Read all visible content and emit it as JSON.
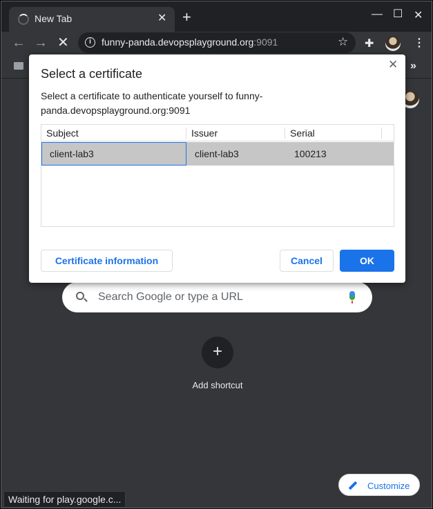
{
  "tab": {
    "title": "New Tab",
    "close": "✕"
  },
  "toolbar": {
    "url_host": "funny-panda.devopsplayground.org",
    "url_port": ":9091"
  },
  "ntp": {
    "search_placeholder": "Search Google or type a URL",
    "shortcut_plus": "+",
    "shortcut_label": "Add shortcut",
    "customize_label": "Customize"
  },
  "status_bar": {
    "text": "Waiting for play.google.c..."
  },
  "dialog": {
    "title": "Select a certificate",
    "close": "✕",
    "message": "Select a certificate to authenticate yourself to funny-panda.devopsplayground.org:9091",
    "columns": [
      "Subject",
      "Issuer",
      "Serial"
    ],
    "rows": [
      {
        "subject": "client-lab3",
        "issuer": "client-lab3",
        "serial": "100213"
      }
    ],
    "cert_info_label": "Certificate information",
    "cancel_label": "Cancel",
    "ok_label": "OK"
  },
  "colors": {
    "accent": "#1a73e8",
    "frame": "#202124",
    "page_bg": "#35363a",
    "selected_row": "#c6c6c6"
  }
}
